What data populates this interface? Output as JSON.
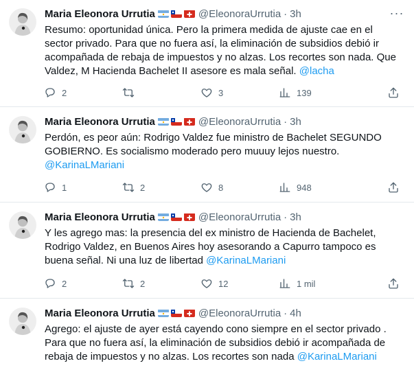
{
  "tweets": [
    {
      "author": "Maria Eleonora Urrutia",
      "handle": "@EleonoraUrrutia",
      "time": "3h",
      "text": "Resumo: oportunidad única. Pero la primera medida de ajuste cae en el sector privado. Para que no fuera así, la eliminación de subsidios debió ir acompañada de rebaja de impuestos y no alzas. Los recortes son nada. Que Valdez, M Hacienda Bachelet II asesore es mala señal. ",
      "mention": "@lacha",
      "replies": "2",
      "retweets": "",
      "likes": "3",
      "views": "139"
    },
    {
      "author": "Maria Eleonora Urrutia",
      "handle": "@EleonoraUrrutia",
      "time": "3h",
      "text": "Perdón, es peor aún: Rodrigo Valdez fue ministro de Bachelet SEGUNDO GOBIERNO. Es socialismo moderado pero muuuy lejos nuestro.\n",
      "mention": "@KarinaLMariani",
      "replies": "1",
      "retweets": "2",
      "likes": "8",
      "views": "948"
    },
    {
      "author": "Maria Eleonora Urrutia",
      "handle": "@EleonoraUrrutia",
      "time": "3h",
      "text": "Y les agrego mas: la presencia del ex ministro de Hacienda de Bachelet, Rodrigo Valdez, en Buenos Aires hoy asesorando a Capurro tampoco es buena señal. Ni una luz de libertad  ",
      "mention": "@KarinaLMariani",
      "replies": "2",
      "retweets": "2",
      "likes": "12",
      "views": "1 mil"
    },
    {
      "author": "Maria Eleonora Urrutia",
      "handle": "@EleonoraUrrutia",
      "time": "4h",
      "text": "Agrego: el ajuste de ayer está cayendo cono siempre en el sector privado . Para que no fuera así, la eliminación de subsidios debió ir acompañada de rebaja de impuestos y no alzas. Los recortes son nada ",
      "mention": "@KarinaLMariani",
      "replies": "",
      "retweets": "",
      "likes": "",
      "views": ""
    }
  ],
  "dot": "·",
  "more_glyph": "···",
  "colors": {
    "accent": "#1d9bf0",
    "muted": "#536471",
    "text": "#0f1419",
    "divider": "#e3e8ec"
  },
  "icons": [
    "reply-icon",
    "retweet-icon",
    "like-icon",
    "views-icon",
    "share-icon",
    "more-icon",
    "flag-argentina-icon",
    "flag-chile-icon",
    "flag-switzerland-icon"
  ]
}
